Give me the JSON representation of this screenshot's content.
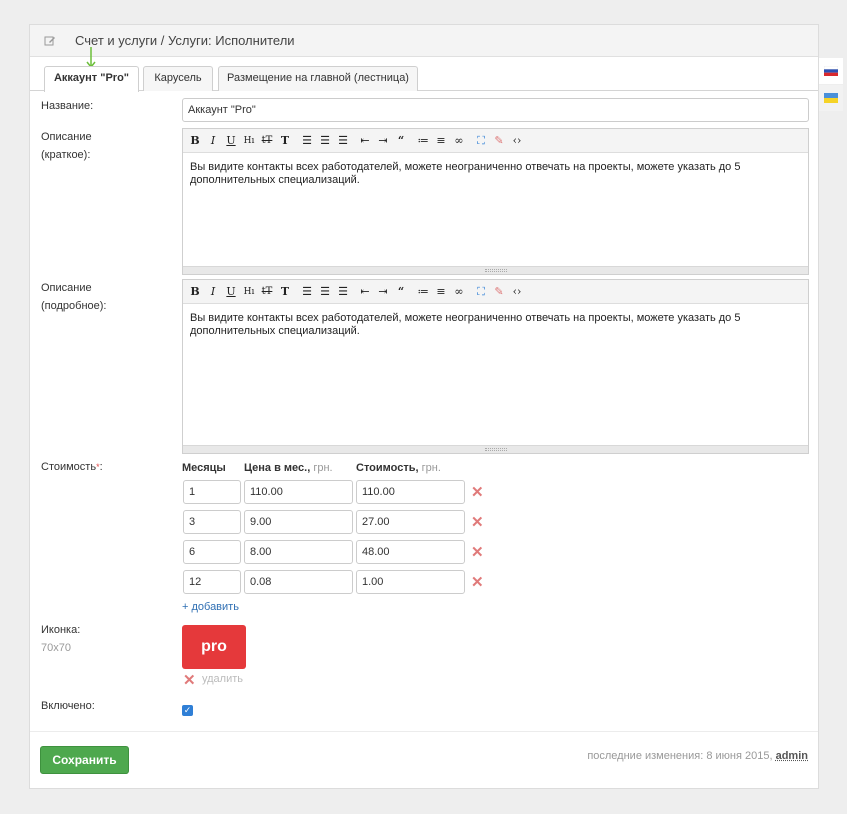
{
  "header": {
    "title": "Счет и услуги / Услуги: Исполнители",
    "icon": "edit-icon"
  },
  "tabs": [
    {
      "label": "Аккаунт \"Pro\"",
      "active": true
    },
    {
      "label": "Карусель",
      "active": false
    },
    {
      "label": "Размещение на главной (лестница)",
      "active": false
    }
  ],
  "form": {
    "name_label": "Название:",
    "name_value": "Аккаунт \"Pro\"",
    "short_desc_label_1": "Описание",
    "short_desc_label_2": "(краткое):",
    "short_desc_text_1": "Вы видите контакты всех работодателей, можете неограниченно отвечать на проекты, можете указать до 5",
    "short_desc_text_2": "дополнительных специализаций.",
    "full_desc_label_1": "Описание",
    "full_desc_label_2": "(подробное):",
    "full_desc_text_1": "Вы видите контакты всех работодателей, можете неограниченно отвечать на проекты, можете указать до 5",
    "full_desc_text_2": "дополнительных специализаций.",
    "cost_label": "Стоимость",
    "cost_required": "*",
    "cost_colon": ":",
    "col_months": "Месяцы",
    "col_price": "Цена в мес.,",
    "col_price_unit": "грн.",
    "col_total": "Стоимость,",
    "col_total_unit": "грн.",
    "add_link": "+ добавить",
    "icon_label": "Иконка:",
    "icon_size": "70x70",
    "icon_text": "pro",
    "delete_link": "удалить",
    "enabled_label": "Включено:",
    "enabled": true
  },
  "price_rows": [
    {
      "months": "1",
      "price": "110.00",
      "total": "110.00"
    },
    {
      "months": "3",
      "price": "9.00",
      "total": "27.00"
    },
    {
      "months": "6",
      "price": "8.00",
      "total": "48.00"
    },
    {
      "months": "12",
      "price": "0.08",
      "total": "1.00"
    }
  ],
  "toolbar": [
    "B",
    "I",
    "U",
    "H1",
    "tT",
    "T",
    "align-left",
    "align-center",
    "align-right",
    "outdent",
    "indent",
    "quote",
    "ol",
    "ul",
    "link",
    "fullscreen",
    "eraser",
    "html"
  ],
  "footer": {
    "save_label": "Сохранить",
    "last_change_prefix": "последние изменения: 8 июня 2015,",
    "last_change_user": "admin"
  },
  "colors": {
    "accent": "#4ea84e",
    "pro_icon": "#e5393b",
    "link": "#2f6fb3"
  }
}
